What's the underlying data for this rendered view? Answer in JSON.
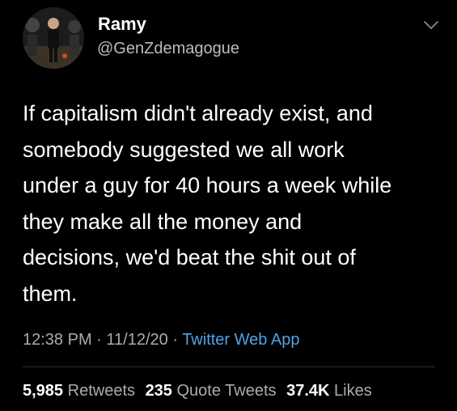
{
  "author": {
    "display_name": "Ramy",
    "handle": "@GenZdemagogue",
    "avatar_icon": "profile-photo"
  },
  "tweet": {
    "text": "If capitalism didn't already exist, and\nsomebody suggested we all work\nunder a guy for 40 hours a week while\nthey make all the money and\ndecisions, we'd beat the shit out of\nthem."
  },
  "meta": {
    "time": "12:38 PM",
    "separator": " · ",
    "date": "11/12/20",
    "source": "Twitter Web App"
  },
  "stats": {
    "retweets_count": "5,985",
    "retweets_label": "Retweets",
    "quotes_count": "235",
    "quotes_label": "Quote Tweets",
    "likes_count": "37.4K",
    "likes_label": "Likes"
  },
  "colors": {
    "background": "#000000",
    "primary_text": "#ffffff",
    "secondary_text": "#a8acb0",
    "link": "#4fa3e8"
  },
  "icons": {
    "more_menu": "chevron-down-icon"
  }
}
